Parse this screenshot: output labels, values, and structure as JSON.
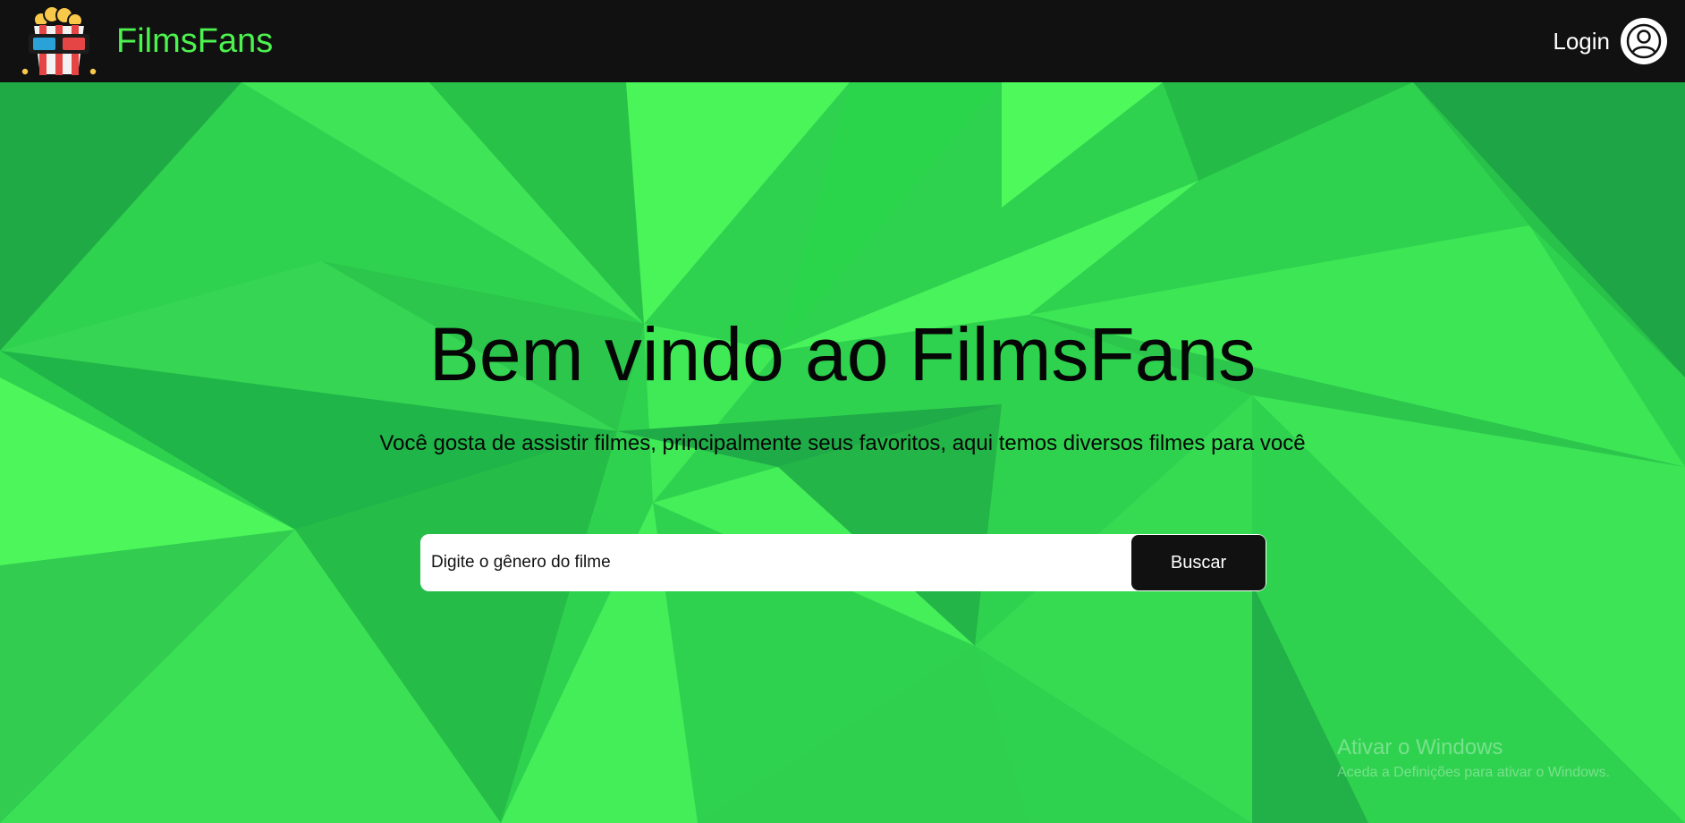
{
  "header": {
    "brand_name": "FilmsFans",
    "logo_icon": "popcorn-3d-glasses-icon",
    "login_label": "Login",
    "user_icon": "user-circle-icon"
  },
  "hero": {
    "title": "Bem vindo ao FilmsFans",
    "subtitle": "Você gosta de assistir filmes, principalmente seus favoritos, aqui temos diversos filmes para você"
  },
  "search": {
    "placeholder": "Digite o gênero do filme",
    "button_label": "Buscar"
  },
  "watermark": {
    "title": "Ativar o Windows",
    "subtitle": "Aceda a Definições para ativar o Windows."
  },
  "colors": {
    "header_bg": "#111111",
    "brand_green": "#4cf24e",
    "background_green": "#2fd14f",
    "button_bg": "#111111"
  }
}
